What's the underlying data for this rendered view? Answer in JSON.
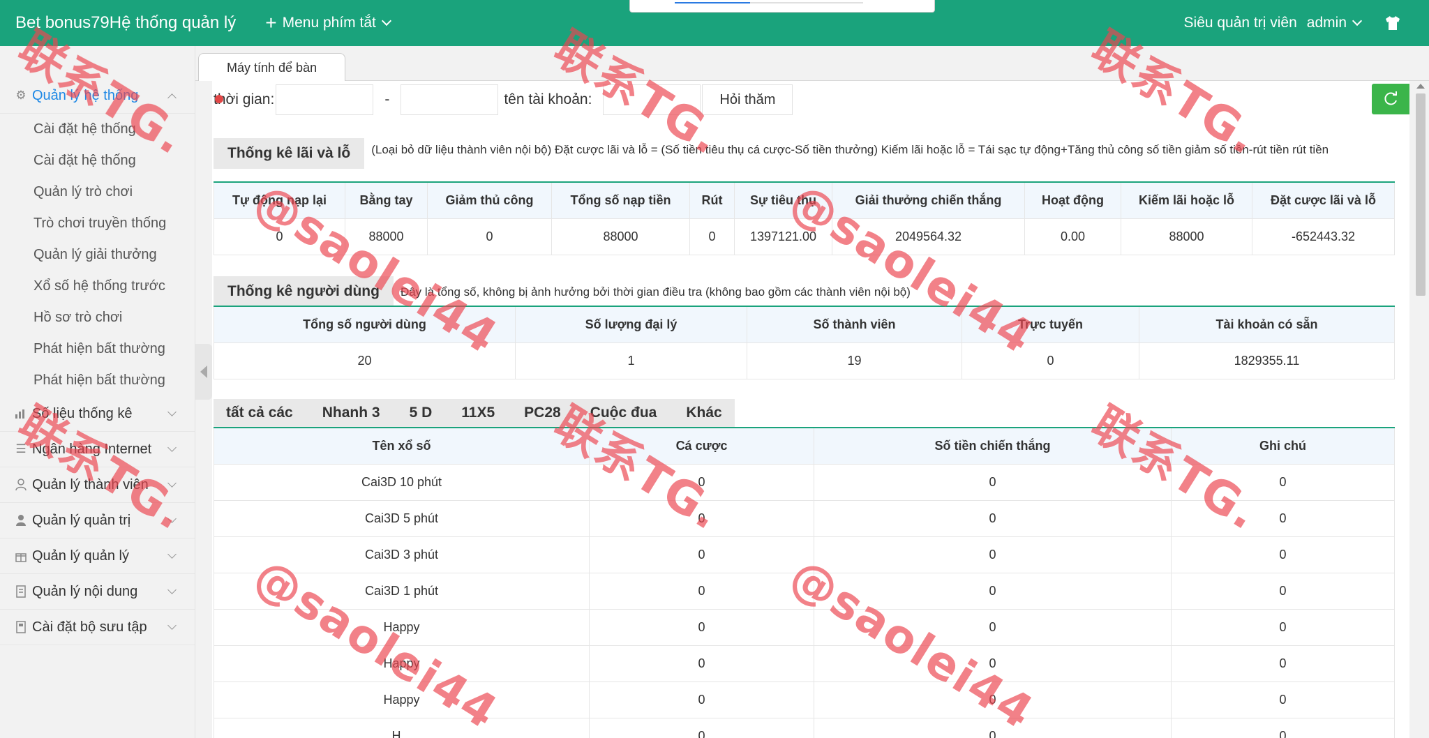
{
  "topbar": {
    "brand": "Bet bonus79Hệ thống quản lý",
    "shortcut_label": "Menu phím tắt",
    "role": "Siêu quản trị viên",
    "user": "admin"
  },
  "sidebar": {
    "system_head": "Quản lý hệ thống",
    "system_items": [
      "Cài đặt hệ thống",
      "Cài đặt hệ thống",
      "Quản lý trò chơi",
      "Trò chơi truyền thống",
      "Quản lý giải thưởng",
      "Xổ số hệ thống trước",
      "Hồ sơ trò chơi",
      "Phát hiện bất thường",
      "Phát hiện bất thường"
    ],
    "heads": [
      "Số liệu thống kê",
      "Ngân hàng Internet",
      "Quản lý thành viên",
      "Quản lý quản trị",
      "Quản lý quản lý",
      "Quản lý nội dung",
      "Cài đặt bộ sưu tập"
    ]
  },
  "tab": {
    "label": "Máy tính để bàn"
  },
  "filter": {
    "time_label": "thời gian:",
    "dash": "-",
    "account_label": "tên tài khoản:",
    "query_button": "Hỏi thăm"
  },
  "profit": {
    "title": "Thống kê lãi và lỗ",
    "note": "(Loại bỏ dữ liệu thành viên nội bộ)  Đặt cược lãi và lỗ = (Số tiền tiêu thụ cá cược-Số tiền thưởng)    Kiếm lãi hoặc lỗ = Tái sạc tự động+Tăng thủ công số tiền giảm số tiền-rút tiền rút tiền",
    "headers": [
      "Tự động nạp lại",
      "Bằng tay",
      "Giảm thủ công",
      "Tổng số nạp tiền",
      "Rút",
      "Sự tiêu thụ",
      "Giải thưởng chiến thắng",
      "Hoạt động",
      "Kiếm lãi hoặc lỗ",
      "Đặt cược lãi và lỗ"
    ],
    "row": [
      "0",
      "88000",
      "0",
      "88000",
      "0",
      "1397121.00",
      "2049564.32",
      "0.00",
      "88000",
      "-652443.32"
    ]
  },
  "users": {
    "title": "Thống kê người dùng",
    "note": "Đây là tổng số, không bị ảnh hưởng bởi thời gian điều tra (không bao gồm các thành viên nội bộ)",
    "headers": [
      "Tổng số người dùng",
      "Số lượng đại lý",
      "Số thành viên",
      "Trực tuyến",
      "Tài khoản có sẵn"
    ],
    "row": [
      "20",
      "1",
      "19",
      "0",
      "1829355.11"
    ]
  },
  "categories": [
    "tất cả các",
    "Nhanh 3",
    "5 D",
    "11X5",
    "PC28",
    "Cuộc đua",
    "Khác"
  ],
  "lottery": {
    "headers": [
      "Tên xổ số",
      "Cá cược",
      "Số tiền chiến thắng",
      "Ghi chú"
    ],
    "rows": [
      [
        "Cai3D 10 phút",
        "0",
        "0",
        "0"
      ],
      [
        "Cai3D 5 phút",
        "0",
        "0",
        "0"
      ],
      [
        "Cai3D 3 phút",
        "0",
        "0",
        "0"
      ],
      [
        "Cai3D 1 phút",
        "0",
        "0",
        "0"
      ],
      [
        "Happy",
        "0",
        "0",
        "0"
      ],
      [
        "Happy",
        "0",
        "0",
        "0"
      ],
      [
        "Happy",
        "0",
        "0",
        "0"
      ],
      [
        "H...",
        "0",
        "0",
        "0"
      ]
    ]
  },
  "watermark": {
    "line1": "联系TG.",
    "line2": "@saolei44"
  }
}
